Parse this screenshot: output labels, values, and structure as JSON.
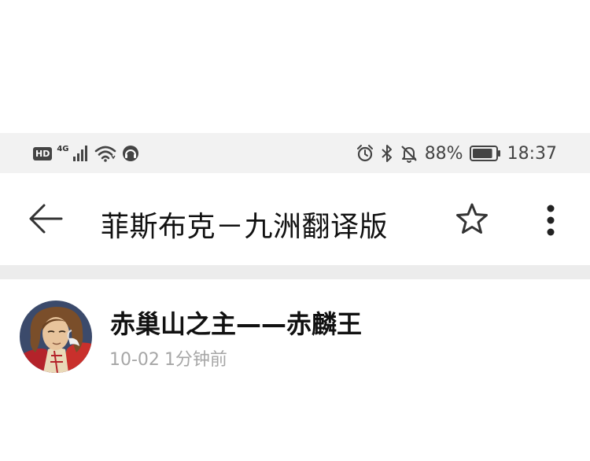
{
  "status_bar": {
    "hd_label": "HD",
    "network_label": "4G",
    "battery_percent": "88%",
    "battery_level": 0.88,
    "time": "18:37"
  },
  "app_bar": {
    "title": "菲斯布克－九洲翻译版",
    "icons": [
      "back-arrow-icon",
      "star-icon",
      "more-vert-icon"
    ]
  },
  "post": {
    "author": "赤巢山之主——赤麟王",
    "date": "10-02",
    "relative_time": "1分钟前"
  },
  "colors": {
    "status_bar_bg": "#f2f2f2",
    "divider": "#ececec",
    "meta_text": "#a6a6a6"
  }
}
